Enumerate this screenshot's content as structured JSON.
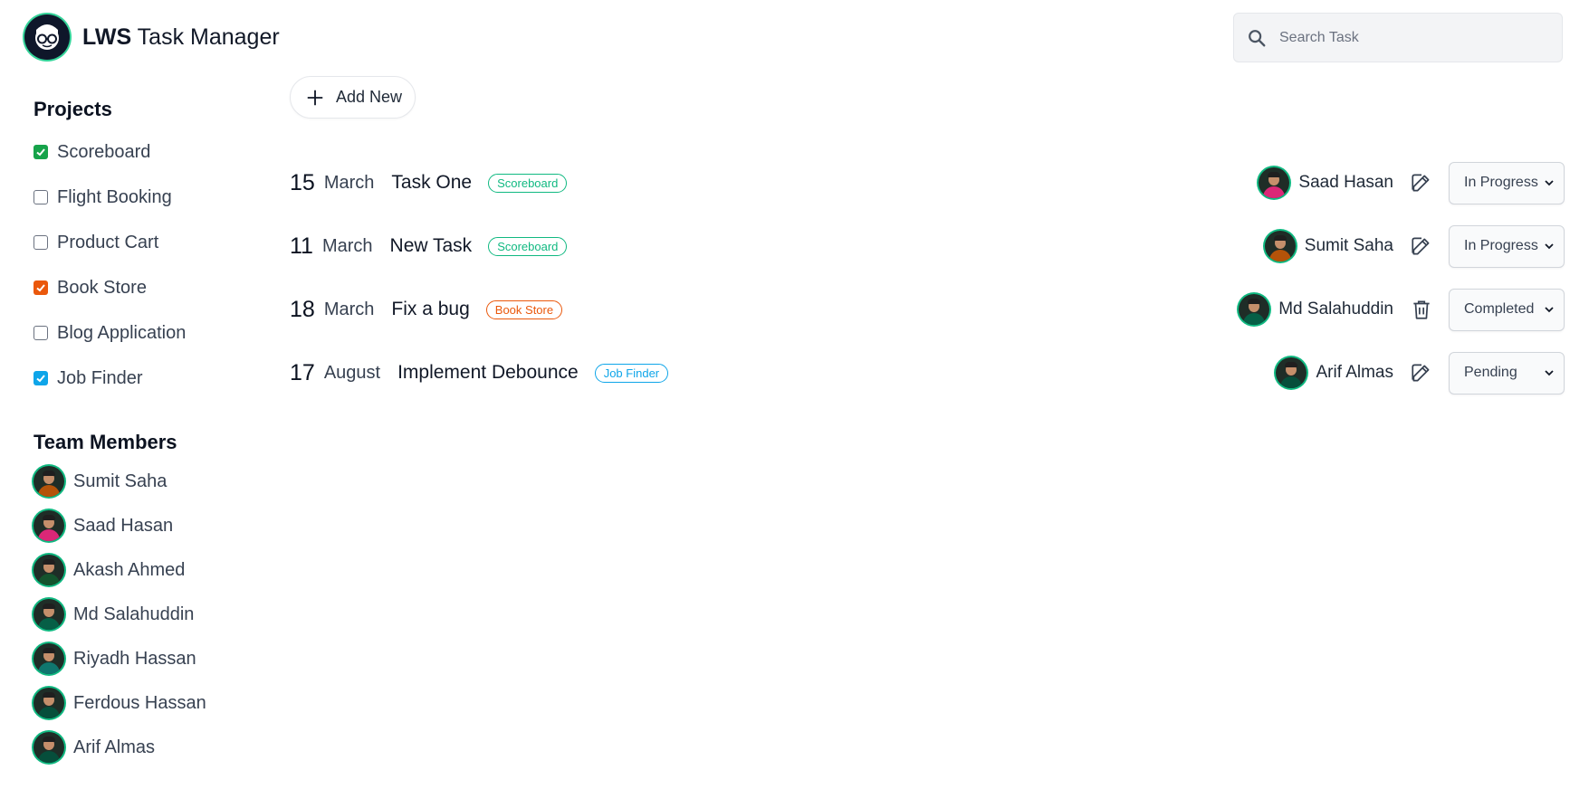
{
  "header": {
    "brand": "LWS",
    "title_rest": "Task Manager"
  },
  "search": {
    "placeholder": "Search Task"
  },
  "sidebar": {
    "projects_title": "Projects",
    "projects": [
      {
        "label": "Scoreboard",
        "checked": true,
        "color": "#16a34a"
      },
      {
        "label": "Flight Booking",
        "checked": false,
        "color": "#6b7280"
      },
      {
        "label": "Product Cart",
        "checked": false,
        "color": "#6b7280"
      },
      {
        "label": "Book Store",
        "checked": true,
        "color": "#ea580c"
      },
      {
        "label": "Blog Application",
        "checked": false,
        "color": "#6b7280"
      },
      {
        "label": "Job Finder",
        "checked": true,
        "color": "#0ea5e9"
      }
    ],
    "members_title": "Team Members",
    "members": [
      {
        "name": "Sumit Saha"
      },
      {
        "name": "Saad Hasan"
      },
      {
        "name": "Akash Ahmed"
      },
      {
        "name": "Md Salahuddin"
      },
      {
        "name": "Riyadh Hassan"
      },
      {
        "name": "Ferdous Hassan"
      },
      {
        "name": "Arif Almas"
      }
    ]
  },
  "toolbar": {
    "add_label": "Add New"
  },
  "tasks": [
    {
      "day": "15",
      "month": "March",
      "name": "Task One",
      "project": "Scoreboard",
      "project_color": "#10b981",
      "assignee": "Saad Hasan",
      "action_icon": "edit-icon",
      "status": "In Progress"
    },
    {
      "day": "11",
      "month": "March",
      "name": "New Task",
      "project": "Scoreboard",
      "project_color": "#10b981",
      "assignee": "Sumit Saha",
      "action_icon": "edit-icon",
      "status": "In Progress"
    },
    {
      "day": "18",
      "month": "March",
      "name": "Fix a bug",
      "project": "Book Store",
      "project_color": "#ea580c",
      "assignee": "Md Salahuddin",
      "action_icon": "trash-icon",
      "status": "Completed"
    },
    {
      "day": "17",
      "month": "August",
      "name": "Implement Debounce",
      "project": "Job Finder",
      "project_color": "#0ea5e9",
      "assignee": "Arif Almas",
      "action_icon": "edit-icon",
      "status": "Pending"
    }
  ]
}
